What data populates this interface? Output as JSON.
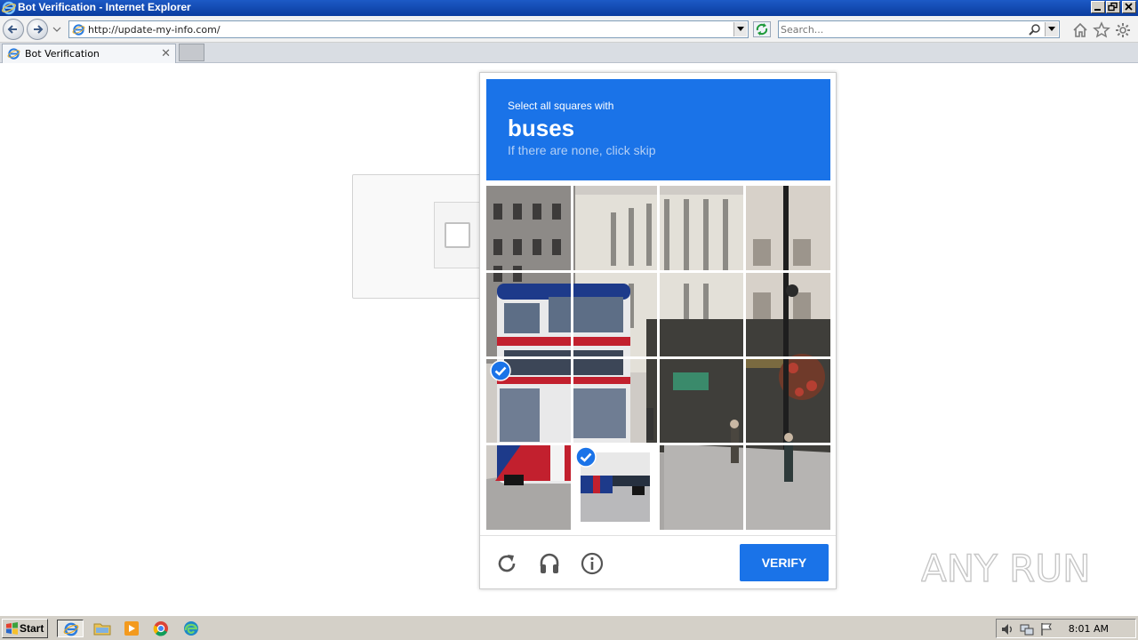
{
  "window": {
    "title": "Bot Verification - Internet Explorer"
  },
  "navbar": {
    "address": "http://update-my-info.com/",
    "search_placeholder": "Search..."
  },
  "tabs": [
    {
      "label": "Bot Verification"
    }
  ],
  "challenge": {
    "instruction_line1": "Select all squares with",
    "keyword": "buses",
    "instruction_line3": "If there are none, click skip",
    "grid": {
      "rows": 4,
      "cols": 4,
      "selected_tiles": [
        "row3-col1",
        "row4-col2"
      ]
    },
    "verify_label": "VERIFY",
    "icons": [
      "reload-icon",
      "audio-icon",
      "info-icon"
    ]
  },
  "watermark": {
    "text": "ANY RUN"
  },
  "taskbar": {
    "start_label": "Start",
    "pinned": [
      "internet-explorer-icon",
      "file-explorer-icon",
      "media-player-icon",
      "chrome-icon",
      "edge-icon"
    ],
    "clock": "8:01 AM"
  },
  "colors": {
    "accent": "#1a73e8",
    "titlebar": "#0a3c9e",
    "taskbar": "#d4d0c8"
  }
}
